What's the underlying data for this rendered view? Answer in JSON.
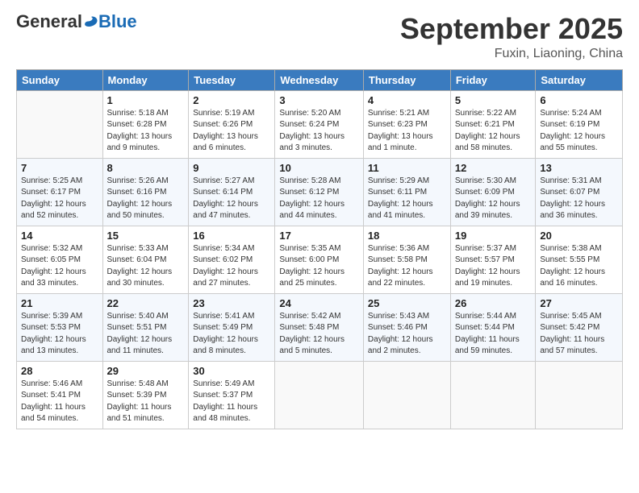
{
  "header": {
    "logo_general": "General",
    "logo_blue": "Blue",
    "month": "September 2025",
    "location": "Fuxin, Liaoning, China"
  },
  "days_of_week": [
    "Sunday",
    "Monday",
    "Tuesday",
    "Wednesday",
    "Thursday",
    "Friday",
    "Saturday"
  ],
  "weeks": [
    [
      {
        "day": "",
        "info": ""
      },
      {
        "day": "1",
        "info": "Sunrise: 5:18 AM\nSunset: 6:28 PM\nDaylight: 13 hours\nand 9 minutes."
      },
      {
        "day": "2",
        "info": "Sunrise: 5:19 AM\nSunset: 6:26 PM\nDaylight: 13 hours\nand 6 minutes."
      },
      {
        "day": "3",
        "info": "Sunrise: 5:20 AM\nSunset: 6:24 PM\nDaylight: 13 hours\nand 3 minutes."
      },
      {
        "day": "4",
        "info": "Sunrise: 5:21 AM\nSunset: 6:23 PM\nDaylight: 13 hours\nand 1 minute."
      },
      {
        "day": "5",
        "info": "Sunrise: 5:22 AM\nSunset: 6:21 PM\nDaylight: 12 hours\nand 58 minutes."
      },
      {
        "day": "6",
        "info": "Sunrise: 5:24 AM\nSunset: 6:19 PM\nDaylight: 12 hours\nand 55 minutes."
      }
    ],
    [
      {
        "day": "7",
        "info": "Sunrise: 5:25 AM\nSunset: 6:17 PM\nDaylight: 12 hours\nand 52 minutes."
      },
      {
        "day": "8",
        "info": "Sunrise: 5:26 AM\nSunset: 6:16 PM\nDaylight: 12 hours\nand 50 minutes."
      },
      {
        "day": "9",
        "info": "Sunrise: 5:27 AM\nSunset: 6:14 PM\nDaylight: 12 hours\nand 47 minutes."
      },
      {
        "day": "10",
        "info": "Sunrise: 5:28 AM\nSunset: 6:12 PM\nDaylight: 12 hours\nand 44 minutes."
      },
      {
        "day": "11",
        "info": "Sunrise: 5:29 AM\nSunset: 6:11 PM\nDaylight: 12 hours\nand 41 minutes."
      },
      {
        "day": "12",
        "info": "Sunrise: 5:30 AM\nSunset: 6:09 PM\nDaylight: 12 hours\nand 39 minutes."
      },
      {
        "day": "13",
        "info": "Sunrise: 5:31 AM\nSunset: 6:07 PM\nDaylight: 12 hours\nand 36 minutes."
      }
    ],
    [
      {
        "day": "14",
        "info": "Sunrise: 5:32 AM\nSunset: 6:05 PM\nDaylight: 12 hours\nand 33 minutes."
      },
      {
        "day": "15",
        "info": "Sunrise: 5:33 AM\nSunset: 6:04 PM\nDaylight: 12 hours\nand 30 minutes."
      },
      {
        "day": "16",
        "info": "Sunrise: 5:34 AM\nSunset: 6:02 PM\nDaylight: 12 hours\nand 27 minutes."
      },
      {
        "day": "17",
        "info": "Sunrise: 5:35 AM\nSunset: 6:00 PM\nDaylight: 12 hours\nand 25 minutes."
      },
      {
        "day": "18",
        "info": "Sunrise: 5:36 AM\nSunset: 5:58 PM\nDaylight: 12 hours\nand 22 minutes."
      },
      {
        "day": "19",
        "info": "Sunrise: 5:37 AM\nSunset: 5:57 PM\nDaylight: 12 hours\nand 19 minutes."
      },
      {
        "day": "20",
        "info": "Sunrise: 5:38 AM\nSunset: 5:55 PM\nDaylight: 12 hours\nand 16 minutes."
      }
    ],
    [
      {
        "day": "21",
        "info": "Sunrise: 5:39 AM\nSunset: 5:53 PM\nDaylight: 12 hours\nand 13 minutes."
      },
      {
        "day": "22",
        "info": "Sunrise: 5:40 AM\nSunset: 5:51 PM\nDaylight: 12 hours\nand 11 minutes."
      },
      {
        "day": "23",
        "info": "Sunrise: 5:41 AM\nSunset: 5:49 PM\nDaylight: 12 hours\nand 8 minutes."
      },
      {
        "day": "24",
        "info": "Sunrise: 5:42 AM\nSunset: 5:48 PM\nDaylight: 12 hours\nand 5 minutes."
      },
      {
        "day": "25",
        "info": "Sunrise: 5:43 AM\nSunset: 5:46 PM\nDaylight: 12 hours\nand 2 minutes."
      },
      {
        "day": "26",
        "info": "Sunrise: 5:44 AM\nSunset: 5:44 PM\nDaylight: 11 hours\nand 59 minutes."
      },
      {
        "day": "27",
        "info": "Sunrise: 5:45 AM\nSunset: 5:42 PM\nDaylight: 11 hours\nand 57 minutes."
      }
    ],
    [
      {
        "day": "28",
        "info": "Sunrise: 5:46 AM\nSunset: 5:41 PM\nDaylight: 11 hours\nand 54 minutes."
      },
      {
        "day": "29",
        "info": "Sunrise: 5:48 AM\nSunset: 5:39 PM\nDaylight: 11 hours\nand 51 minutes."
      },
      {
        "day": "30",
        "info": "Sunrise: 5:49 AM\nSunset: 5:37 PM\nDaylight: 11 hours\nand 48 minutes."
      },
      {
        "day": "",
        "info": ""
      },
      {
        "day": "",
        "info": ""
      },
      {
        "day": "",
        "info": ""
      },
      {
        "day": "",
        "info": ""
      }
    ]
  ]
}
